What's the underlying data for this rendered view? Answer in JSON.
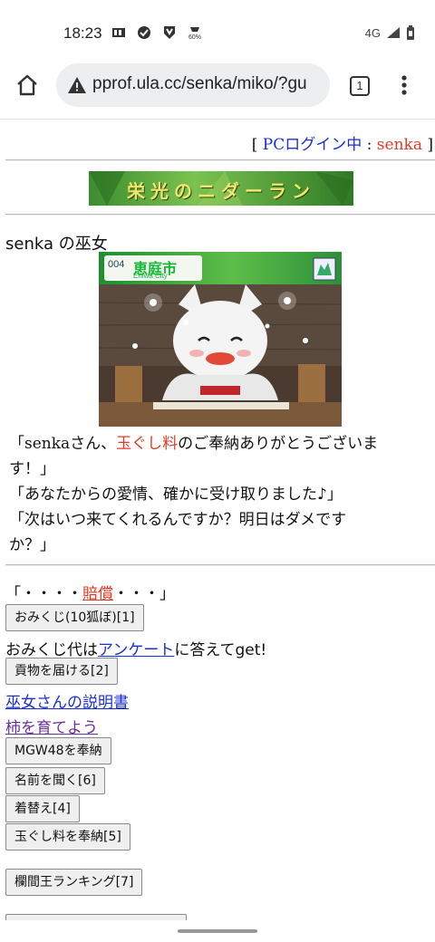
{
  "status_bar": {
    "time": "18:23",
    "icons_left": [
      "sim-icon",
      "check-circle-icon",
      "shield-icon",
      "battery-saver-icon"
    ],
    "network": "4G"
  },
  "browser": {
    "url": "pprof.ula.cc/senka/miko/?gu",
    "tab_count": "1"
  },
  "page": {
    "login": {
      "open_bracket": "[",
      "label": "PCログイン中",
      "sep": ":",
      "user": "senka",
      "close_bracket": "]"
    },
    "banner_text": "栄光のニダーラン",
    "title": "senka の巫女",
    "scene": {
      "city_num": "004",
      "city_jp": "恵庭市",
      "city_en": "Eniwa City"
    },
    "quote1_a": "「senkaさん、",
    "quote1_red": "玉ぐし料",
    "quote1_b": "のご奉納ありがとうございま",
    "quote1_c": "す！」",
    "quote2": "「あなたからの愛情、確かに受け取りました♪」",
    "quote3_a": "「次はいつ来てくれるんですか？明日はダメです",
    "quote3_b": "か？」",
    "dots_a": "「・・・・",
    "dots_link": "賠償",
    "dots_b": "・・・」",
    "omikuji_btn": "おみくじ(10狐ぼ)[1]",
    "omikuji_text_a": "おみくじ代は",
    "omikuji_link": "アンケート",
    "omikuji_text_b": "に答えてget!",
    "tribute_btn": "貢物を届ける[2]",
    "manual_link": "巫女さんの説明書",
    "persimmon_link": "柿を育てよう",
    "mgw_btn": "MGW48を奉納",
    "name_btn": "名前を聞く[6]",
    "dress_btn": "着替え[4]",
    "tamagushi_btn": "玉ぐし料を奉納[5]",
    "ranking_btn": "欄間王ランキング[7]"
  },
  "colors": {
    "link": "#1a2fd6",
    "red_text": "#e03a24",
    "visited": "#6a2fa0"
  }
}
